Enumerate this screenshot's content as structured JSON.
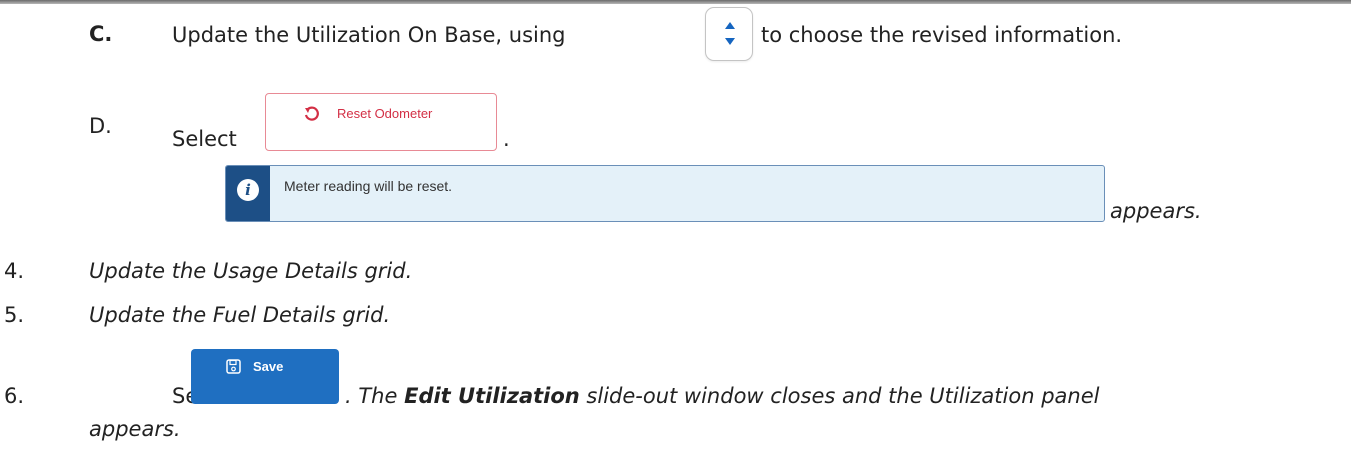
{
  "steps": {
    "c": {
      "marker": "C.",
      "text_before": "Update the Utilization On Base, using",
      "text_after": "to choose the revised information."
    },
    "d": {
      "marker": "D.",
      "select": "Select",
      "period": ".",
      "button_label": "Reset Odometer",
      "alert_message": "Meter reading will be reset.",
      "appears": "appears."
    },
    "s4": {
      "marker": "4.",
      "text": "Update the Usage Details grid."
    },
    "s5": {
      "marker": "5.",
      "text": "Update the Fuel Details grid."
    },
    "s6": {
      "marker": "6.",
      "select": "Select",
      "button_label": "Save",
      "text_after_1": ". The",
      "emphasis": "Edit Utilization",
      "text_after_2": "slide-out window closes and the Utilization panel",
      "text_line2": "appears."
    }
  },
  "icons": {
    "spinner": "spinner-arrows-icon",
    "reset": "undo-icon",
    "info": "info-icon",
    "save": "floppy-disk-icon"
  },
  "colors": {
    "accent": "#1f6fc1",
    "reset_text": "#d32f45",
    "alert_bg": "#e4f1f9",
    "alert_side": "#1d4f86"
  }
}
